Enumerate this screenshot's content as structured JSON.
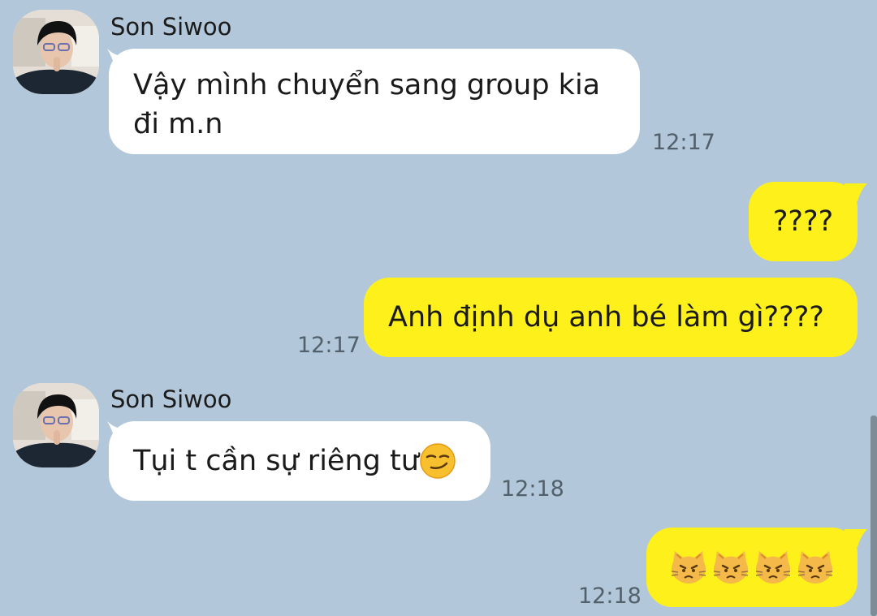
{
  "chat": {
    "messages": [
      {
        "type": "incoming",
        "sender": "Son Siwoo",
        "text": "Vậy mình chuyển sang group kia\nđi m.n",
        "time": "12:17"
      },
      {
        "type": "outgoing",
        "text": "????",
        "time": ""
      },
      {
        "type": "outgoing",
        "text": "Anh định dụ anh bé làm gì????",
        "time": "12:17"
      },
      {
        "type": "incoming",
        "sender": "Son Siwoo",
        "text": "Tụi t cần sự riêng tư",
        "emoji": "smirking-face",
        "time": "12:18"
      },
      {
        "type": "outgoing",
        "text": "",
        "emoji": "pouting-cat-face x4",
        "time": "12:18"
      }
    ]
  },
  "colors": {
    "background": "#b2c7d9",
    "incoming_bubble": "#ffffff",
    "outgoing_bubble": "#fef01b",
    "timestamp": "#52606b"
  }
}
